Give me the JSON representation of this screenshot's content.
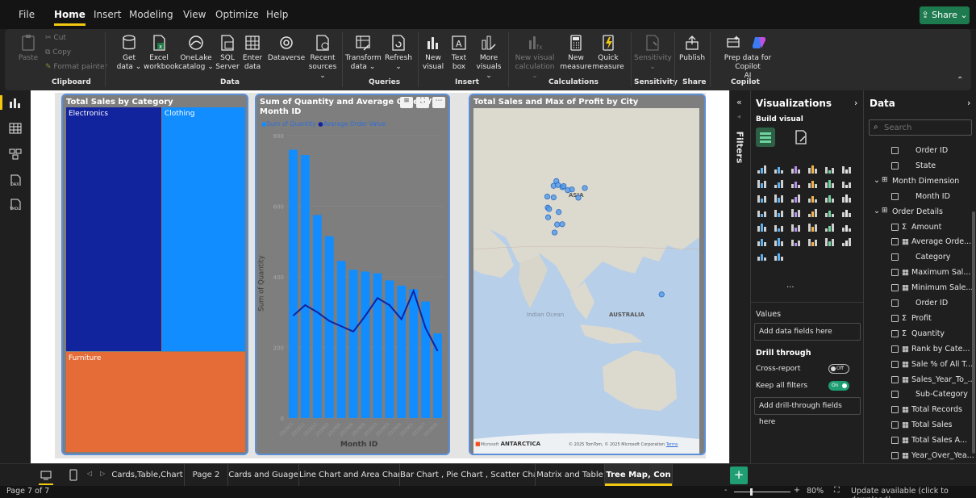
{
  "menubar": {
    "items": [
      "File",
      "Home",
      "Insert",
      "Modeling",
      "View",
      "Optimize",
      "Help"
    ],
    "active": "Home",
    "share_label": "Share"
  },
  "ribbon": {
    "clipboard": {
      "paste": "Paste",
      "cut": "Cut",
      "copy": "Copy",
      "format_painter": "Format painter",
      "group": "Clipboard"
    },
    "data": {
      "get_data": [
        "Get",
        "data"
      ],
      "excel": [
        "Excel",
        "workbook"
      ],
      "onelake": [
        "OneLake",
        "catalog"
      ],
      "sql": [
        "SQL",
        "Server"
      ],
      "enter": [
        "Enter",
        "data"
      ],
      "dataverse": [
        "Dataverse",
        ""
      ],
      "recent": [
        "Recent",
        "sources"
      ],
      "group": "Data"
    },
    "queries": {
      "transform": [
        "Transform",
        "data"
      ],
      "refresh": [
        "Refresh",
        ""
      ],
      "group": "Queries"
    },
    "insert": {
      "new_visual": [
        "New",
        "visual"
      ],
      "text_box": [
        "Text",
        "box"
      ],
      "more_visuals": [
        "More",
        "visuals"
      ],
      "group": "Insert"
    },
    "calculations": {
      "new_visual_calc": [
        "New visual",
        "calculation"
      ],
      "new_measure": [
        "New",
        "measure"
      ],
      "quick_measure": [
        "Quick",
        "measure"
      ],
      "group": "Calculations"
    },
    "sensitivity": {
      "label": [
        "Sensitivity",
        ""
      ],
      "group": "Sensitivity"
    },
    "share": {
      "publish": [
        "Publish",
        ""
      ],
      "group": "Share"
    },
    "copilot": {
      "prep": [
        "Prep data for Copilot",
        "AI"
      ],
      "group": "Copilot"
    }
  },
  "visuals": {
    "treemap": {
      "title": "Total Sales by Category",
      "tiles": [
        {
          "label": "Electronics",
          "color": "#12239e"
        },
        {
          "label": "Clothing",
          "color": "#118dff"
        },
        {
          "label": "Furniture",
          "color": "#e66c37"
        }
      ]
    },
    "combo": {
      "title_line1": "Sum of Quantity and Average Order V",
      "title_line2": "Month ID",
      "legend": [
        "Sum of Quantity",
        "Average Order Value"
      ],
      "xlabel": "Month ID",
      "ylabel": "Sum of Quantity"
    },
    "map": {
      "title": "Total Sales and Max of Profit by City",
      "labels": [
        "ASIA",
        "AUSTRALIA",
        "Indian Ocean",
        "ANTARCTICA"
      ],
      "footer_brand": "Microsoft",
      "attribution": "© 2025 TomTom, © 2025 Microsoft Corporation",
      "terms": "Terms"
    }
  },
  "chart_data": {
    "type": "bar",
    "title": "Sum of Quantity and Average Order Value by Month ID",
    "xlabel": "Month ID",
    "ylabel": "Sum of Quantity",
    "y_ticks": [
      0,
      200,
      400,
      600,
      800
    ],
    "ylim": [
      0,
      800
    ],
    "categories": [
      "201803",
      "201811",
      "201812",
      "201902",
      "201905",
      "201906",
      "201908",
      "201910",
      "201903",
      "201904",
      "201901",
      "201907",
      "201809"
    ],
    "series": [
      {
        "name": "Sum of Quantity",
        "kind": "bar",
        "color": "#118dff",
        "values": [
          760,
          745,
          575,
          515,
          445,
          420,
          415,
          410,
          390,
          375,
          365,
          330,
          240
        ]
      },
      {
        "name": "Average Order Value",
        "kind": "line",
        "color": "#12239e",
        "values": [
          290,
          320,
          300,
          275,
          260,
          245,
          290,
          340,
          320,
          280,
          360,
          255,
          190
        ]
      }
    ]
  },
  "map_points": [
    {
      "lon": 72.8,
      "lat": 19.0
    },
    {
      "lon": 73.5,
      "lat": 18.5
    },
    {
      "lon": 77.2,
      "lat": 28.6
    },
    {
      "lon": 75.8,
      "lat": 26.9
    },
    {
      "lon": 78.0,
      "lat": 27.2
    },
    {
      "lon": 80.3,
      "lat": 26.4
    },
    {
      "lon": 80.9,
      "lat": 26.8
    },
    {
      "lon": 77.6,
      "lat": 12.9
    },
    {
      "lon": 80.2,
      "lat": 13.0
    },
    {
      "lon": 78.4,
      "lat": 17.4
    },
    {
      "lon": 72.6,
      "lat": 23.0
    },
    {
      "lon": 75.8,
      "lat": 22.7
    },
    {
      "lon": 76.3,
      "lat": 10.0
    },
    {
      "lon": 88.4,
      "lat": 22.6
    },
    {
      "lon": 85.1,
      "lat": 25.6
    },
    {
      "lon": 73.0,
      "lat": 15.5
    },
    {
      "lon": 83.0,
      "lat": 25.3
    },
    {
      "lon": 91.7,
      "lat": 26.1
    },
    {
      "lon": 130.8,
      "lat": -12.4
    }
  ],
  "filters_label": "Filters",
  "vispane": {
    "title": "Visualizations",
    "build_visual": "Build visual",
    "values_label": "Values",
    "add_fields": "Add data fields here",
    "drill_through": "Drill through",
    "cross_report": "Cross-report",
    "cross_report_state": "Off",
    "keep_filters": "Keep all filters",
    "keep_filters_state": "On",
    "add_drill": "Add drill-through fields here",
    "more": "..."
  },
  "datapane": {
    "title": "Data",
    "search_placeholder": "Search",
    "fields": [
      {
        "label": "Order ID",
        "level": 2,
        "type": "plain"
      },
      {
        "label": "State",
        "level": 2,
        "type": "plain"
      },
      {
        "label": "Month Dimension",
        "level": 1,
        "type": "table",
        "expanded": true
      },
      {
        "label": "Month ID",
        "level": 2,
        "type": "plain"
      },
      {
        "label": "Order Details",
        "level": 1,
        "type": "table",
        "expanded": true
      },
      {
        "label": "Amount",
        "level": 2,
        "type": "sum"
      },
      {
        "label": "Average Orde...",
        "level": 2,
        "type": "measure"
      },
      {
        "label": "Category",
        "level": 2,
        "type": "plain"
      },
      {
        "label": "Maximum Sal...",
        "level": 2,
        "type": "measure"
      },
      {
        "label": "Minimum Sale...",
        "level": 2,
        "type": "measure"
      },
      {
        "label": "Order ID",
        "level": 2,
        "type": "plain"
      },
      {
        "label": "Profit",
        "level": 2,
        "type": "sum"
      },
      {
        "label": "Quantity",
        "level": 2,
        "type": "sum"
      },
      {
        "label": "Rank by Cate...",
        "level": 2,
        "type": "measure"
      },
      {
        "label": "Sale % of All T...",
        "level": 2,
        "type": "measure"
      },
      {
        "label": "Sales_Year_To_...",
        "level": 2,
        "type": "measure"
      },
      {
        "label": "Sub-Category",
        "level": 2,
        "type": "plain"
      },
      {
        "label": "Total Records",
        "level": 2,
        "type": "measure"
      },
      {
        "label": "Total Sales",
        "level": 2,
        "type": "measure"
      },
      {
        "label": "Total Sales A...",
        "level": 2,
        "type": "measure"
      },
      {
        "label": "Year_Over_Yea...",
        "level": 2,
        "type": "measure"
      },
      {
        "label": "Sales target",
        "level": 1,
        "type": "table",
        "expanded": false
      }
    ]
  },
  "tabs": [
    {
      "label": "Cards,Table,Chart",
      "active": false
    },
    {
      "label": "Page 2",
      "active": false
    },
    {
      "label": "Cards and Guage",
      "active": false
    },
    {
      "label": "Line Chart and Area Chart",
      "active": false
    },
    {
      "label": "Bar Chart , Pie Chart , Scatter Chart",
      "active": false
    },
    {
      "label": "Matrix and Table",
      "active": false
    },
    {
      "label": "Tree Map, Con",
      "active": true
    }
  ],
  "add_page": "+",
  "status": {
    "page": "Page 7 of 7",
    "zoom_minus": "-",
    "zoom_plus": "+",
    "zoom": "80%",
    "update": "Update available (click to download)"
  },
  "colors": {
    "accent": "#f2c811",
    "share": "#1e7a4f",
    "selection": "#5b8fd6",
    "toggle_on": "#1e9e72"
  }
}
